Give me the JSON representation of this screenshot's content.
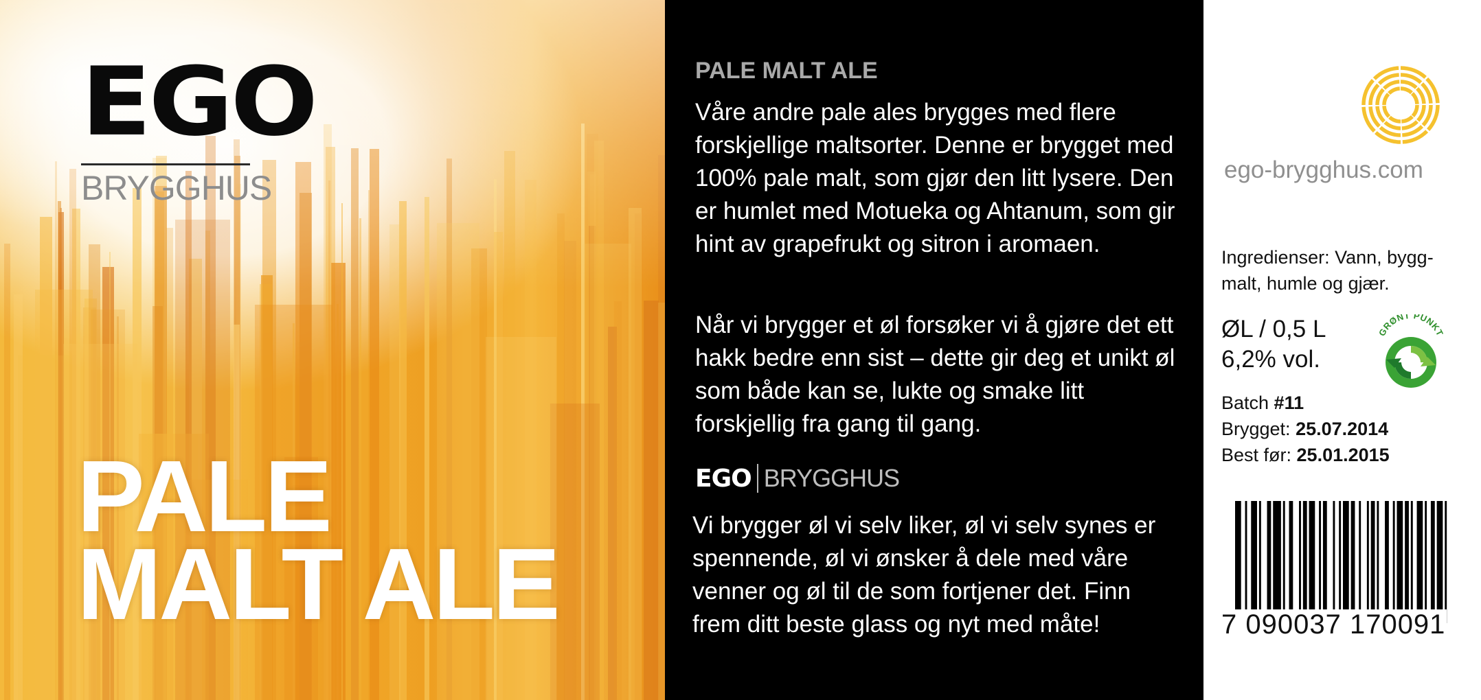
{
  "brand": {
    "name": "EGO",
    "subtitle": "BRYGGHUS"
  },
  "label": {
    "title_line1": "PALE",
    "title_line2": "MALT ALE"
  },
  "description": {
    "heading": "PALE MALT ALE",
    "paragraph1": "Våre andre pale ales brygges med flere forskjellige maltsorter. Denne er brygget med 100% pale malt, som gjør den litt lysere. Den er humlet med Motueka og Ahtanum, som gir hint av grapefrukt og sitron i aromaen.",
    "paragraph2": "Når vi brygger et øl forsøker vi å gjøre det ett hakk bedre enn sist – dette gir deg et unikt øl som både kan se, lukte og smake litt forskjellig fra gang til gang.",
    "mini_logo_main": "EGO",
    "mini_logo_sub": "BRYGGHUS",
    "paragraph3": "Vi brygger øl vi selv liker, øl vi selv synes er spennende, øl vi ønsker å dele med våre venner og øl til de som fortjener det. Finn frem ditt beste glass og nyt med måte!"
  },
  "info": {
    "website": "ego-brygghus.com",
    "ingredients": "Ingredienser: Vann, bygg-malt, humle og gjær.",
    "volume": "ØL / 0,5 L",
    "abv": "6,2% vol.",
    "batch_label": "Batch ",
    "batch_value": "#11",
    "brewed_label": "Brygget: ",
    "brewed_value": "25.07.2014",
    "best_before_label": "Best før: ",
    "best_before_value": "25.01.2015",
    "green_dot_text": "GRØNT PUNKT",
    "barcode_number": "7 090037 170091"
  },
  "colors": {
    "accent_orange": "#ee9f22",
    "sun_yellow": "#f5c12e",
    "green_dot": "#3aa335",
    "panel_black": "#000000"
  },
  "icons": [
    "sun-logo-icon",
    "green-dot-icon",
    "barcode-icon"
  ]
}
